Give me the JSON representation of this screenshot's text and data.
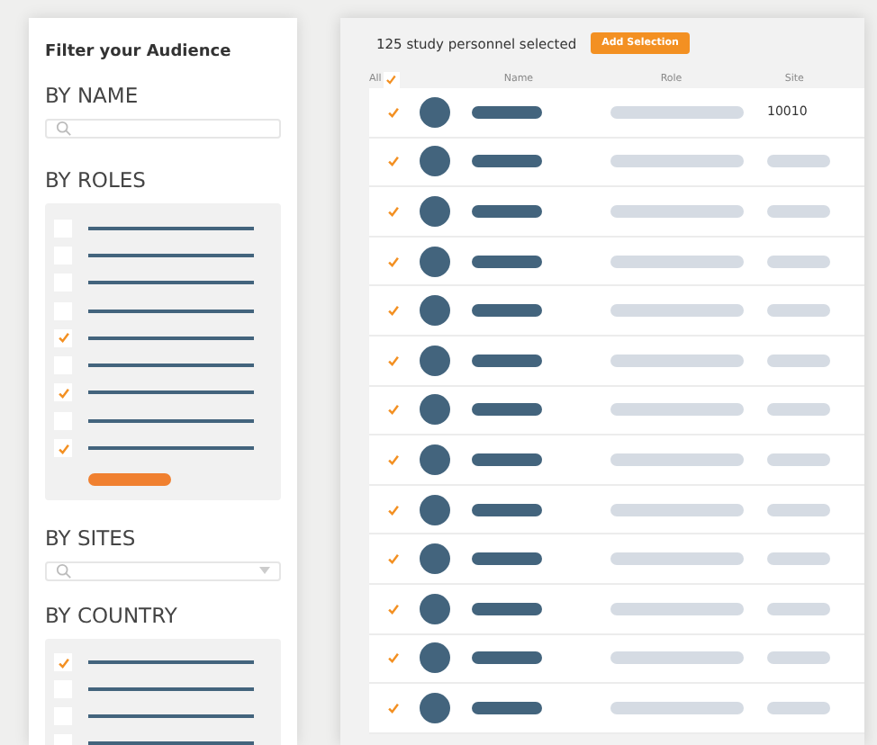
{
  "filter_panel": {
    "title": "Filter your Audience",
    "by_name": {
      "heading": "BY NAME"
    },
    "by_roles": {
      "heading": "BY ROLES",
      "items": [
        {
          "checked": false
        },
        {
          "checked": false
        },
        {
          "checked": false
        },
        {
          "checked": false
        },
        {
          "checked": true
        },
        {
          "checked": false
        },
        {
          "checked": true
        },
        {
          "checked": false
        },
        {
          "checked": true
        }
      ]
    },
    "by_sites": {
      "heading": "BY SITES"
    },
    "by_country": {
      "heading": "BY COUNTRY",
      "items": [
        {
          "checked": true
        },
        {
          "checked": false
        },
        {
          "checked": false
        },
        {
          "checked": false
        }
      ]
    }
  },
  "selection_panel": {
    "summary": "125 study personnel selected",
    "add_button": "Add Selection",
    "select_all": {
      "label": "All",
      "checked": true
    },
    "columns": [
      "Name",
      "Role",
      "Site"
    ],
    "rows": [
      {
        "checked": true,
        "site": "10010"
      },
      {
        "checked": true
      },
      {
        "checked": true
      },
      {
        "checked": true
      },
      {
        "checked": true
      },
      {
        "checked": true
      },
      {
        "checked": true
      },
      {
        "checked": true
      },
      {
        "checked": true
      },
      {
        "checked": true
      },
      {
        "checked": true
      },
      {
        "checked": true
      },
      {
        "checked": true
      }
    ]
  }
}
